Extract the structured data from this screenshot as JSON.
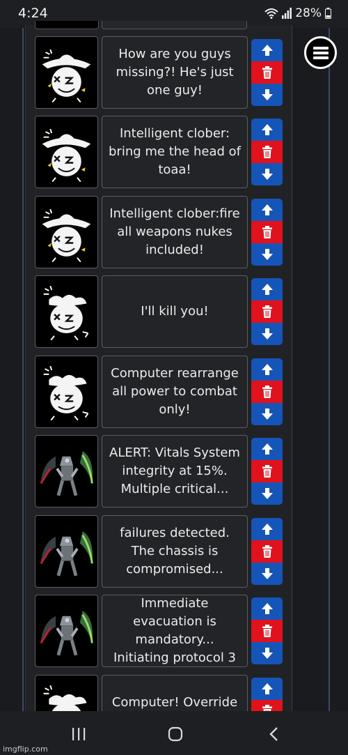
{
  "status_bar": {
    "time": "4:24",
    "battery": "28%"
  },
  "messages": [
    {
      "avatar": "clober-hat",
      "text": "How are you guys missing?! He's just one guy!"
    },
    {
      "avatar": "clober-hat",
      "text": "Intelligent clober: bring me the head of toaa!"
    },
    {
      "avatar": "clober-hat",
      "text": "Intelligent clober:fire all weapons nukes included!"
    },
    {
      "avatar": "clober-smoke",
      "text": "I'll kill you!"
    },
    {
      "avatar": "clober-smoke",
      "text": "Computer rearrange all power to combat only!"
    },
    {
      "avatar": "mecha-scythe",
      "text": "ALERT: Vitals System integrity at 15%. Multiple critical..."
    },
    {
      "avatar": "mecha-scythe",
      "text": "failures detected. The chassis is compromised..."
    },
    {
      "avatar": "mecha-scythe",
      "text": "Immediate evacuation is mandatory... Initiating protocol 3"
    },
    {
      "avatar": "clober-smoke",
      "text": "Computer! Override"
    }
  ],
  "icons": {
    "move_up": "arrow-up-icon",
    "delete": "trash-icon",
    "move_down": "arrow-down-icon",
    "menu": "hamburger-menu-icon"
  },
  "colors": {
    "move": "#1655b8",
    "delete": "#e0121c",
    "background": "#1a1b1e"
  },
  "watermark": "imgflip.com"
}
